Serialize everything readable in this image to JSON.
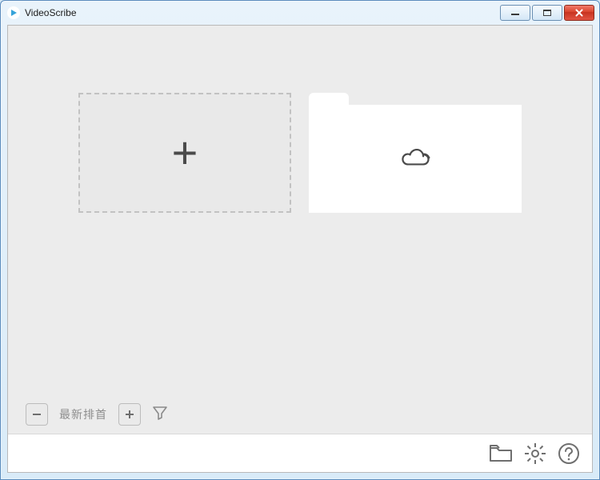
{
  "window": {
    "title": "VideoScribe"
  },
  "toolbar": {
    "sort_label": "最新排首"
  },
  "tiles": {
    "new_scribe": {
      "icon": "plus"
    },
    "cloud_folder": {
      "icon": "cloud"
    }
  },
  "icons": {
    "minimize": "minimize",
    "maximize": "maximize",
    "close": "close",
    "zoom_out": "−",
    "zoom_in": "+",
    "filter": "funnel",
    "folder": "folder",
    "settings": "gear",
    "help": "?"
  }
}
